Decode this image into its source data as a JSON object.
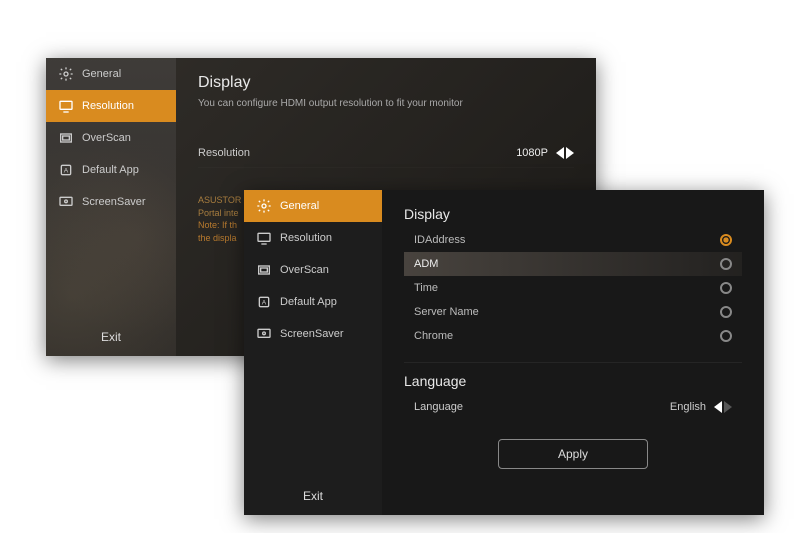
{
  "colors": {
    "accent": "#d98b1f"
  },
  "back": {
    "sidebar": {
      "items": [
        {
          "icon": "gear-icon",
          "label": "General"
        },
        {
          "icon": "monitor-icon",
          "label": "Resolution"
        },
        {
          "icon": "overscan-icon",
          "label": "OverScan"
        },
        {
          "icon": "app-icon",
          "label": "Default App"
        },
        {
          "icon": "screensaver-icon",
          "label": "ScreenSaver"
        }
      ],
      "exit": "Exit"
    },
    "title": "Display",
    "caption": "You can configure  HDMI output resolution to  fit your monitor",
    "resolution": {
      "label": "Resolution",
      "value": "1080P"
    },
    "note_line1": "ASUSTOR",
    "note_line2": "Portal inte",
    "note_line3": "Note: If th",
    "note_line4": "the displa"
  },
  "front": {
    "sidebar": {
      "items": [
        {
          "icon": "gear-icon",
          "label": "General"
        },
        {
          "icon": "monitor-icon",
          "label": "Resolution"
        },
        {
          "icon": "overscan-icon",
          "label": "OverScan"
        },
        {
          "icon": "app-icon",
          "label": "Default App"
        },
        {
          "icon": "screensaver-icon",
          "label": "ScreenSaver"
        }
      ],
      "exit": "Exit"
    },
    "display": {
      "title": "Display",
      "items": [
        {
          "label": "IDAddress",
          "selected": true
        },
        {
          "label": "ADM",
          "selected": false
        },
        {
          "label": "Time",
          "selected": false
        },
        {
          "label": "Server Name",
          "selected": false
        },
        {
          "label": "Chrome",
          "selected": false
        }
      ]
    },
    "language": {
      "title": "Language",
      "label": "Language",
      "value": "English"
    },
    "apply": "Apply"
  }
}
